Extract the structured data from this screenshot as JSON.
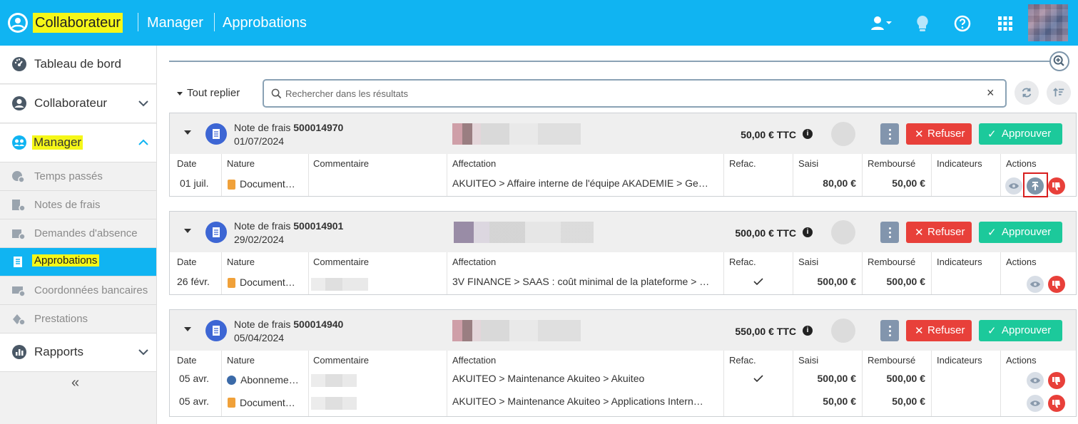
{
  "header": {
    "crumb_collaborateur": "Collaborateur",
    "crumb_manager": "Manager",
    "crumb_approbations": "Approbations",
    "icons": [
      "user-switch-icon",
      "lightbulb-icon",
      "help-icon",
      "apps-grid-icon"
    ],
    "accent": "#10b4f2",
    "highlight": "#f5f718"
  },
  "sidebar": {
    "main_items": [
      {
        "label": "Tableau de bord",
        "icon": "dashboard-icon"
      },
      {
        "label": "Collaborateur",
        "icon": "user-icon"
      },
      {
        "label": "Manager",
        "icon": "manager-icon"
      },
      {
        "label": "Rapports",
        "icon": "reports-icon"
      }
    ],
    "sub_items": [
      {
        "label": "Temps passés",
        "icon": "time-icon"
      },
      {
        "label": "Notes de frais",
        "icon": "expenses-icon"
      },
      {
        "label": "Demandes d'absence",
        "icon": "absence-icon"
      },
      {
        "label": "Approbations",
        "icon": "approvals-icon"
      },
      {
        "label": "Coordonnées bancaires",
        "icon": "bank-icon"
      },
      {
        "label": "Prestations",
        "icon": "services-icon"
      }
    ],
    "collapse_label": "«"
  },
  "toolbar": {
    "collapse_all": "Tout replier",
    "search_placeholder": "Rechercher dans les résultats",
    "clear": "×"
  },
  "columns": [
    "Date",
    "Nature",
    "Commentaire",
    "Affectation",
    "Refac.",
    "Saisi",
    "Remboursé",
    "Indicateurs",
    "Actions"
  ],
  "buttons": {
    "refuse": "Refuser",
    "approve": "Approuver"
  },
  "cards": [
    {
      "title_prefix": "Note de frais",
      "number": "500014970",
      "date": "01/07/2024",
      "amount": "50,00 € TTC",
      "rows": [
        {
          "date": "01 juil.",
          "nature": "Document…",
          "nature_icon": "document-icon",
          "comment": "",
          "affectation": "AKUITEO > Affaire interne de l'équipe AKADEMIE > Ge…",
          "refac": false,
          "saisi": "80,00 €",
          "rembourse": "50,00 €"
        }
      ]
    },
    {
      "title_prefix": "Note de frais",
      "number": "500014901",
      "date": "29/02/2024",
      "amount": "500,00 € TTC",
      "rows": [
        {
          "date": "26 févr.",
          "nature": "Document…",
          "nature_icon": "document-icon",
          "comment": "",
          "affectation": "3V FINANCE > SAAS : coût minimal de la plateforme > …",
          "refac": true,
          "saisi": "500,00 €",
          "rembourse": "500,00 €"
        }
      ]
    },
    {
      "title_prefix": "Note de frais",
      "number": "500014940",
      "date": "05/04/2024",
      "amount": "550,00 € TTC",
      "rows": [
        {
          "date": "05 avr.",
          "nature": "Abonneme…",
          "nature_icon": "wordpress-icon",
          "comment": "",
          "affectation": "AKUITEO > Maintenance Akuiteo > Akuiteo",
          "refac": true,
          "saisi": "500,00 €",
          "rembourse": "500,00 €"
        },
        {
          "date": "05 avr.",
          "nature": "Document…",
          "nature_icon": "document-icon",
          "comment": "",
          "affectation": "AKUITEO > Maintenance Akuiteo > Applications Intern…",
          "refac": false,
          "saisi": "50,00 €",
          "rembourse": "50,00 €"
        }
      ]
    }
  ]
}
